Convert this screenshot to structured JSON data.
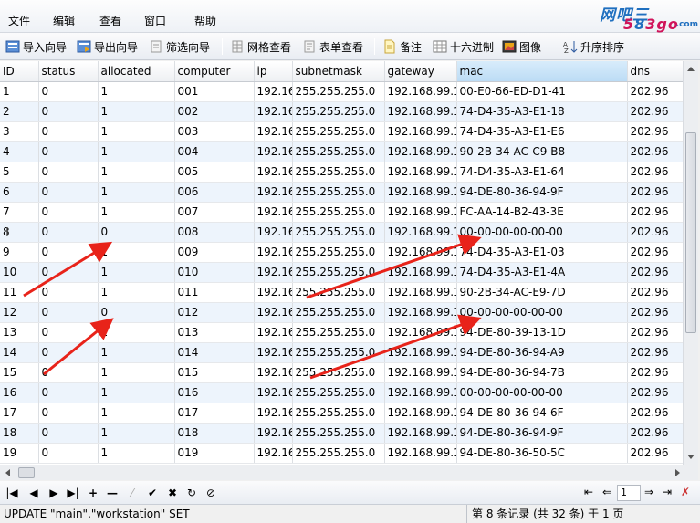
{
  "menu": [
    "文件",
    "编辑",
    "查看",
    "窗口",
    "帮助"
  ],
  "logo": {
    "line1": "网吧",
    "line1b": "三",
    "line2a": "5",
    "line2b": "8",
    "line2c": "3go",
    "line3": ".com"
  },
  "toolbar": {
    "import": "导入向导",
    "export": "导出向导",
    "filter": "筛选向导",
    "grid_view": "网格查看",
    "form_view": "表单查看",
    "memo": "备注",
    "hex": "十六进制",
    "image": "图像",
    "sort_asc": "升序排序"
  },
  "columns": [
    "ID",
    "status",
    "allocated",
    "computer",
    "ip",
    "subnetmask",
    "gateway",
    "mac",
    "dns"
  ],
  "selected_column": "mac",
  "rows": [
    [
      "1",
      "0",
      "1",
      "001",
      "192.16",
      "255.255.255.0",
      "192.168.99.1",
      "00-E0-66-ED-D1-41",
      "202.96"
    ],
    [
      "2",
      "0",
      "1",
      "002",
      "192.16",
      "255.255.255.0",
      "192.168.99.1",
      "74-D4-35-A3-E1-18",
      "202.96"
    ],
    [
      "3",
      "0",
      "1",
      "003",
      "192.16",
      "255.255.255.0",
      "192.168.99.1",
      "74-D4-35-A3-E1-E6",
      "202.96"
    ],
    [
      "4",
      "0",
      "1",
      "004",
      "192.16",
      "255.255.255.0",
      "192.168.99.1",
      "90-2B-34-AC-C9-B8",
      "202.96"
    ],
    [
      "5",
      "0",
      "1",
      "005",
      "192.16",
      "255.255.255.0",
      "192.168.99.1",
      "74-D4-35-A3-E1-64",
      "202.96"
    ],
    [
      "6",
      "0",
      "1",
      "006",
      "192.16",
      "255.255.255.0",
      "192.168.99.1",
      "94-DE-80-36-94-9F",
      "202.96"
    ],
    [
      "7",
      "0",
      "1",
      "007",
      "192.16",
      "255.255.255.0",
      "192.168.99.1",
      "FC-AA-14-B2-43-3E",
      "202.96"
    ],
    [
      "8",
      "0",
      "0",
      "008",
      "192.16",
      "255.255.255.0",
      "192.168.99.1",
      "00-00-00-00-00-00",
      "202.96"
    ],
    [
      "9",
      "0",
      "1",
      "009",
      "192.16",
      "255.255.255.0",
      "192.168.99.1",
      "74-D4-35-A3-E1-03",
      "202.96"
    ],
    [
      "10",
      "0",
      "1",
      "010",
      "192.16",
      "255.255.255.0",
      "192.168.99.1",
      "74-D4-35-A3-E1-4A",
      "202.96"
    ],
    [
      "11",
      "0",
      "1",
      "011",
      "192.16",
      "255.255.255.0",
      "192.168.99.1",
      "90-2B-34-AC-E9-7D",
      "202.96"
    ],
    [
      "12",
      "0",
      "0",
      "012",
      "192.16",
      "255.255.255.0",
      "192.168.99.1",
      "00-00-00-00-00-00",
      "202.96"
    ],
    [
      "13",
      "0",
      "1",
      "013",
      "192.16",
      "255.255.255.0",
      "192.168.99.1",
      "94-DE-80-39-13-1D",
      "202.96"
    ],
    [
      "14",
      "0",
      "1",
      "014",
      "192.16",
      "255.255.255.0",
      "192.168.99.1",
      "94-DE-80-36-94-A9",
      "202.96"
    ],
    [
      "15",
      "0",
      "1",
      "015",
      "192.16",
      "255.255.255.0",
      "192.168.99.1",
      "94-DE-80-36-94-7B",
      "202.96"
    ],
    [
      "16",
      "0",
      "1",
      "016",
      "192.16",
      "255.255.255.0",
      "192.168.99.1",
      "00-00-00-00-00-00",
      "202.96"
    ],
    [
      "17",
      "0",
      "1",
      "017",
      "192.16",
      "255.255.255.0",
      "192.168.99.1",
      "94-DE-80-36-94-6F",
      "202.96"
    ],
    [
      "18",
      "0",
      "1",
      "018",
      "192.16",
      "255.255.255.0",
      "192.168.99.1",
      "94-DE-80-36-94-9F",
      "202.96"
    ],
    [
      "19",
      "0",
      "1",
      "019",
      "192.16",
      "255.255.255.0",
      "192.168.99.1",
      "94-DE-80-36-50-5C",
      "202.96"
    ]
  ],
  "nav": {
    "page": "1"
  },
  "status": {
    "left": "UPDATE \"main\".\"workstation\" SET",
    "right": "第 8 条记录 (共 32 条) 于 1 页"
  },
  "colors": {
    "annotation": "#e8231a",
    "selected_header": "#bcdcf5",
    "alt_row": "#edf4fc"
  }
}
